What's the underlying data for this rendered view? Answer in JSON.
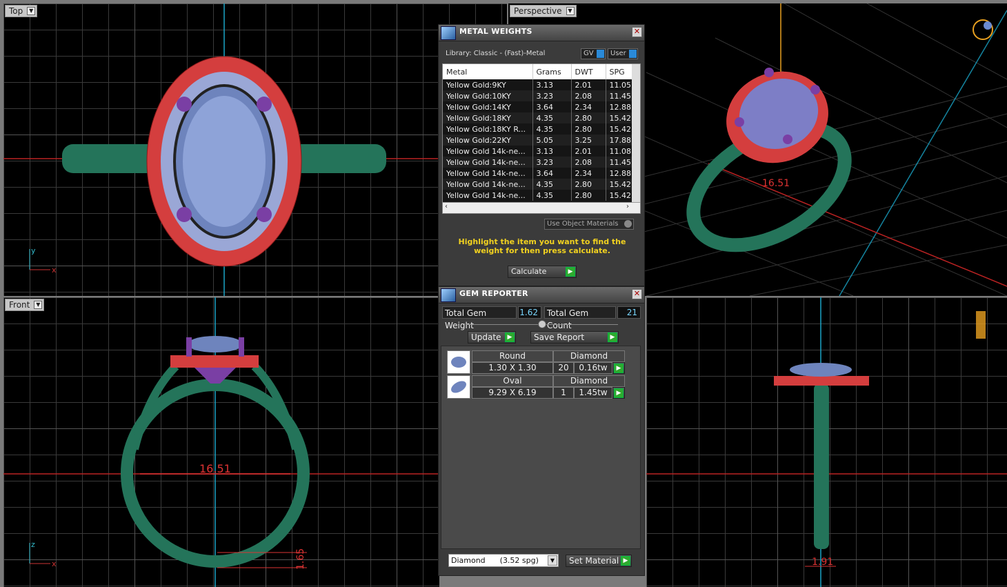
{
  "viewports": {
    "top": {
      "label": "Top",
      "axis_y": "y",
      "axis_x": "x"
    },
    "perspective": {
      "label": "Perspective",
      "dimension": "16.51"
    },
    "front": {
      "label": "Front",
      "dimension": "16.51",
      "height_dim": "1.65",
      "axis_z": "z",
      "axis_x": "x"
    },
    "side": {
      "dimension": "1.91"
    }
  },
  "metal_weights": {
    "title": "METAL WEIGHTS",
    "library": "Library: Classic - (Fast)-Metal",
    "gv_label": "GV",
    "user_label": "User",
    "columns": [
      "Metal",
      "Grams",
      "DWT",
      "SPG"
    ],
    "rows": [
      [
        "Yellow Gold:9KY",
        "3.13",
        "2.01",
        "11.05"
      ],
      [
        "Yellow Gold:10KY",
        "3.23",
        "2.08",
        "11.45"
      ],
      [
        "Yellow Gold:14KY",
        "3.64",
        "2.34",
        "12.88"
      ],
      [
        "Yellow Gold:18KY",
        "4.35",
        "2.80",
        "15.42"
      ],
      [
        "Yellow Gold:18KY R...",
        "4.35",
        "2.80",
        "15.42"
      ],
      [
        "Yellow Gold:22KY",
        "5.05",
        "3.25",
        "17.88"
      ],
      [
        "Yellow Gold 14k-ne...",
        "3.13",
        "2.01",
        "11.08"
      ],
      [
        "Yellow Gold 14k-ne...",
        "3.23",
        "2.08",
        "11.45"
      ],
      [
        "Yellow Gold 14k-ne...",
        "3.64",
        "2.34",
        "12.88"
      ],
      [
        "Yellow Gold 14k-ne...",
        "4.35",
        "2.80",
        "15.42"
      ],
      [
        "Yellow Gold 14k-ne...",
        "4.35",
        "2.80",
        "15.42"
      ]
    ],
    "use_object_materials": "Use Object Materials",
    "hint": "Highlight the item you want to find the weight for then press calculate.",
    "calculate": "Calculate"
  },
  "gem_reporter": {
    "title": "GEM REPORTER",
    "total_weight_label": "Total Gem Weight",
    "total_weight": "1.62",
    "total_count_label": "Total Gem Count",
    "total_count": "21",
    "update": "Update",
    "save_report": "Save Report",
    "gems": [
      {
        "shape": "Round",
        "material": "Diamond",
        "size": "1.30 X 1.30",
        "count": "20",
        "weight": "0.16tw"
      },
      {
        "shape": "Oval",
        "material": "Diamond",
        "size": "9.29 X 6.19",
        "count": "1",
        "weight": "1.45tw"
      }
    ],
    "material_select": "Diamond      (3.52 spg)",
    "set_material": "Set Material"
  }
}
